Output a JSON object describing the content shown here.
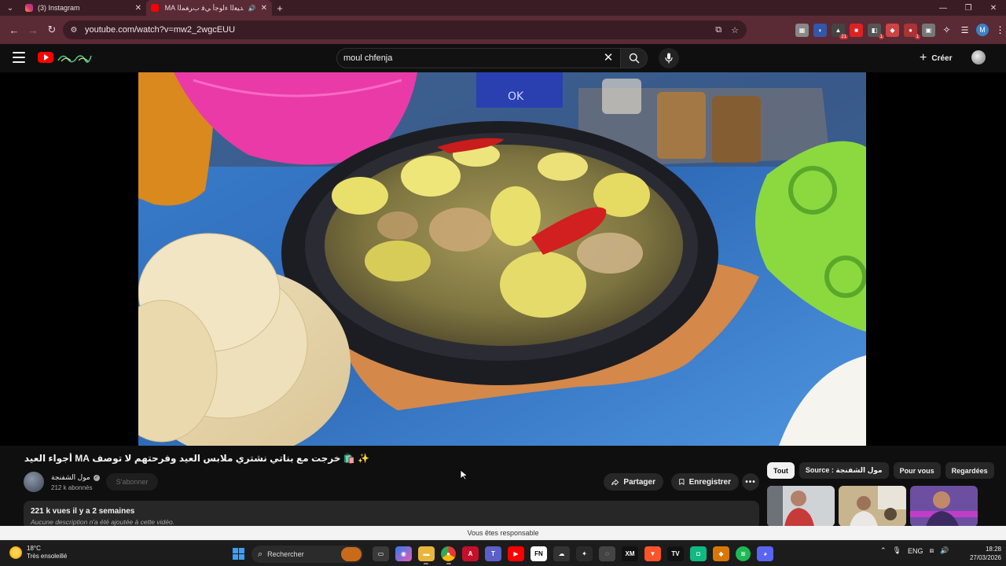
{
  "browser": {
    "tabs": [
      {
        "title": "(3) Instagram",
        "active": false
      },
      {
        "title": "ﺪﻴﻌﻟا ءاﻮﺟأ ﻲﻓ بﺮﻐﻤﻟا MA -.ﺟ",
        "active": true
      }
    ],
    "url": "youtube.com/watch?v=mw2_2wgcEUU"
  },
  "youtube": {
    "search_value": "moul chfenja",
    "create_label": "Créer",
    "video_title": "✨ 🛍️ خرجت مع بناتي نشتري ملابس العيد وفرحتهم لا توصف MA أجواء العيد في المغرب",
    "channel_name": "مول الشفنجة",
    "subscribers": "212 k abonnés",
    "subscribe_label": "S'abonner",
    "share_label": "Partager",
    "save_label": "Enregistrer",
    "description": {
      "stats": "221 k vues  il y a 2 semaines",
      "text": "Aucune description n'a été ajoutée à cette vidéo."
    },
    "chips": [
      {
        "label": "Tout",
        "active": true
      },
      {
        "label": "Source : مول الشفنجة",
        "active": false
      },
      {
        "label": "Pour vous",
        "active": false
      },
      {
        "label": "Regardées",
        "active": false
      }
    ]
  },
  "notice": "Vous êtes responsable",
  "taskbar": {
    "weather_temp": "18°C",
    "weather_desc": "Très ensoleillé",
    "search_label": "Rechercher",
    "language": "ENG",
    "time": "18:28",
    "date": "27/03/2026"
  },
  "extensions": {
    "badges": [
      "21",
      "1",
      "1"
    ]
  },
  "profile_initial": "M"
}
